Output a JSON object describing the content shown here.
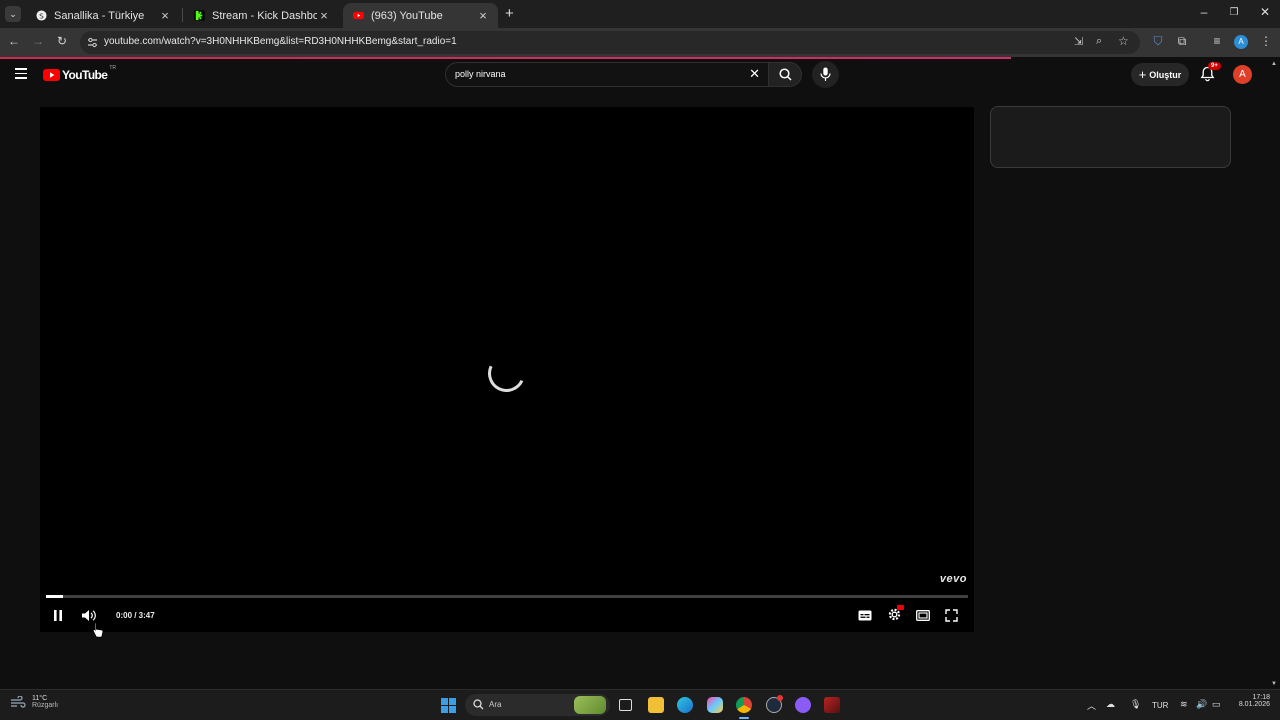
{
  "browser": {
    "tabs": [
      {
        "title": "Sanallika - Türkiye",
        "active": false
      },
      {
        "title": "Stream - Kick Dashboard",
        "active": false
      },
      {
        "title": "(963) YouTube",
        "active": true
      }
    ],
    "url": "youtube.com/watch?v=3H0NHHKBemg&list=RD3H0NHHKBemg&start_radio=1",
    "page_load_progress": 0.79
  },
  "youtube": {
    "logo_text": "YouTube",
    "region_badge": "TR",
    "search_value": "polly nirvana",
    "create_label": "Oluştur",
    "notification_badge": "9+",
    "avatar_letter": "A"
  },
  "player": {
    "time_display": "0:00 / 3:47",
    "watermark": "vevo",
    "progress_fraction": 0.018,
    "state": "loading"
  },
  "taskbar": {
    "weather_temp": "11°C",
    "weather_desc": "Rüzgarlı",
    "search_placeholder": "Ara",
    "language": "TUR",
    "time": "17:18",
    "date": "8.01.2026"
  },
  "colors": {
    "youtube_red": "#ff0000",
    "kick_green": "#53fc18",
    "avatar": "#e0402a"
  }
}
